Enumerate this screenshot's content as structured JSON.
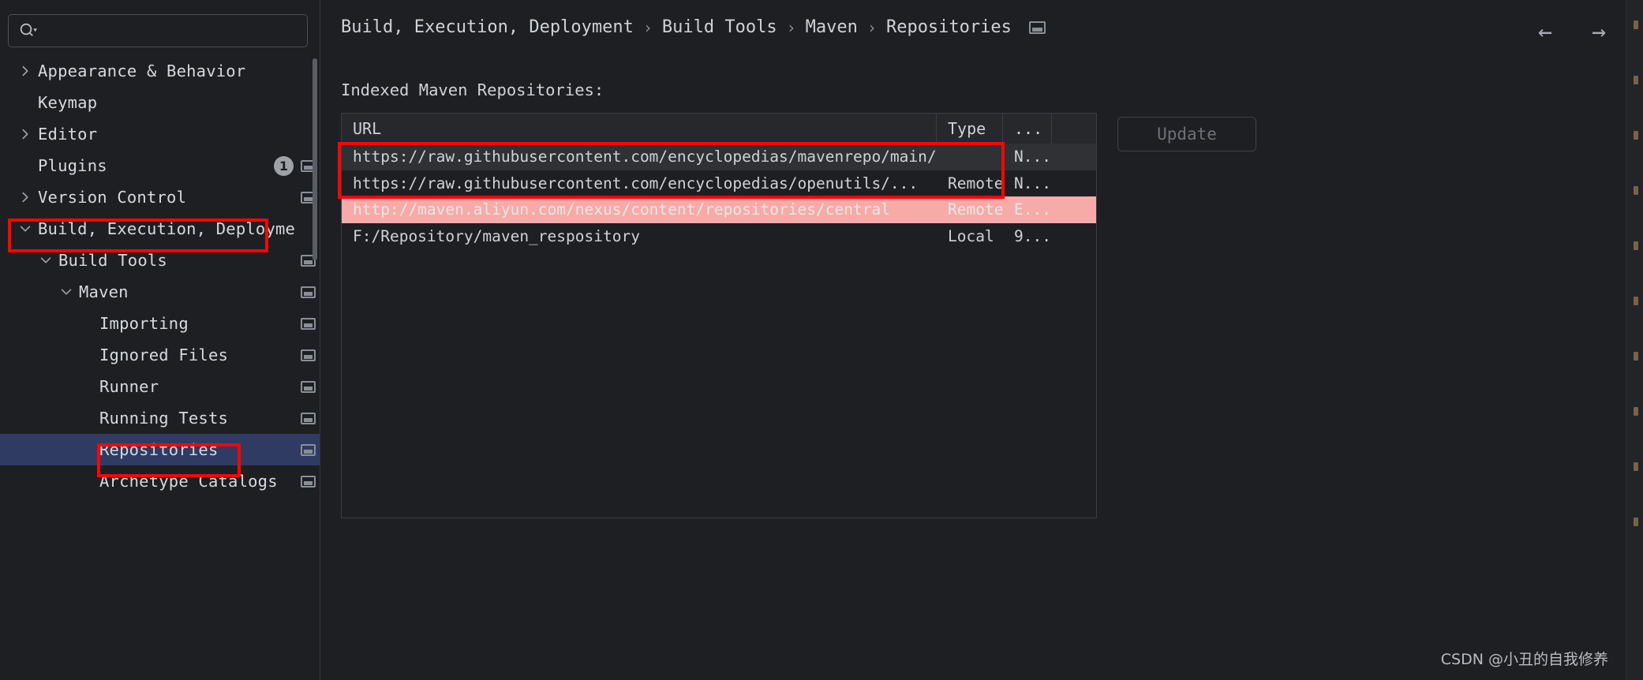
{
  "search": {
    "placeholder": "",
    "value": "",
    "icon": "search-icon"
  },
  "sidebar": {
    "items": [
      {
        "label": "Appearance & Behavior",
        "indent": 0,
        "chevron": "right",
        "badge": null,
        "win_icon": false,
        "selected": false
      },
      {
        "label": "Keymap",
        "indent": 0,
        "chevron": "none",
        "badge": null,
        "win_icon": false,
        "selected": false
      },
      {
        "label": "Editor",
        "indent": 0,
        "chevron": "right",
        "badge": null,
        "win_icon": false,
        "selected": false
      },
      {
        "label": "Plugins",
        "indent": 0,
        "chevron": "none",
        "badge": "1",
        "win_icon": true,
        "selected": false
      },
      {
        "label": "Version Control",
        "indent": 0,
        "chevron": "right",
        "badge": null,
        "win_icon": true,
        "selected": false
      },
      {
        "label": "Build, Execution, Deployme",
        "indent": 0,
        "chevron": "down",
        "badge": null,
        "win_icon": false,
        "selected": false
      },
      {
        "label": "Build Tools",
        "indent": 1,
        "chevron": "down",
        "badge": null,
        "win_icon": true,
        "selected": false
      },
      {
        "label": "Maven",
        "indent": 2,
        "chevron": "down",
        "badge": null,
        "win_icon": true,
        "selected": false
      },
      {
        "label": "Importing",
        "indent": 3,
        "chevron": "none",
        "badge": null,
        "win_icon": true,
        "selected": false
      },
      {
        "label": "Ignored Files",
        "indent": 3,
        "chevron": "none",
        "badge": null,
        "win_icon": true,
        "selected": false
      },
      {
        "label": "Runner",
        "indent": 3,
        "chevron": "none",
        "badge": null,
        "win_icon": true,
        "selected": false
      },
      {
        "label": "Running Tests",
        "indent": 3,
        "chevron": "none",
        "badge": null,
        "win_icon": true,
        "selected": false
      },
      {
        "label": "Repositories",
        "indent": 3,
        "chevron": "none",
        "badge": null,
        "win_icon": true,
        "selected": true
      },
      {
        "label": "Archetype Catalogs",
        "indent": 3,
        "chevron": "none",
        "badge": null,
        "win_icon": true,
        "selected": false
      }
    ]
  },
  "header": {
    "breadcrumb": [
      "Build, Execution, Deployment",
      "Build Tools",
      "Maven",
      "Repositories"
    ],
    "separator": "›",
    "settings_icon": "window-settings-icon",
    "back_label": "←",
    "forward_label": "→"
  },
  "main": {
    "section_title": "Indexed Maven Repositories:",
    "update_button": "Update",
    "table": {
      "columns": [
        "URL",
        "Type",
        "...",
        ""
      ],
      "rows": [
        {
          "url": "https://raw.githubusercontent.com/encyclopedias/mavenrepo/main/repo",
          "type": "",
          "dots": "N...",
          "state": "selected"
        },
        {
          "url": "https://raw.githubusercontent.com/encyclopedias/openutils/...",
          "type": "Remote",
          "dots": "N...",
          "state": "normal"
        },
        {
          "url": "http://maven.aliyun.com/nexus/content/repositories/central",
          "type": "Remote",
          "dots": "E...",
          "state": "error"
        },
        {
          "url": "F:/Repository/maven_respository",
          "type": "Local",
          "dots": "9...",
          "state": "normal"
        }
      ]
    }
  },
  "annotations": {
    "color": "#fa0505",
    "boxes": [
      "build-execution-deployment-item",
      "repositories-item",
      "github-repo-rows"
    ]
  },
  "watermark": "CSDN @小丑的自我修养"
}
